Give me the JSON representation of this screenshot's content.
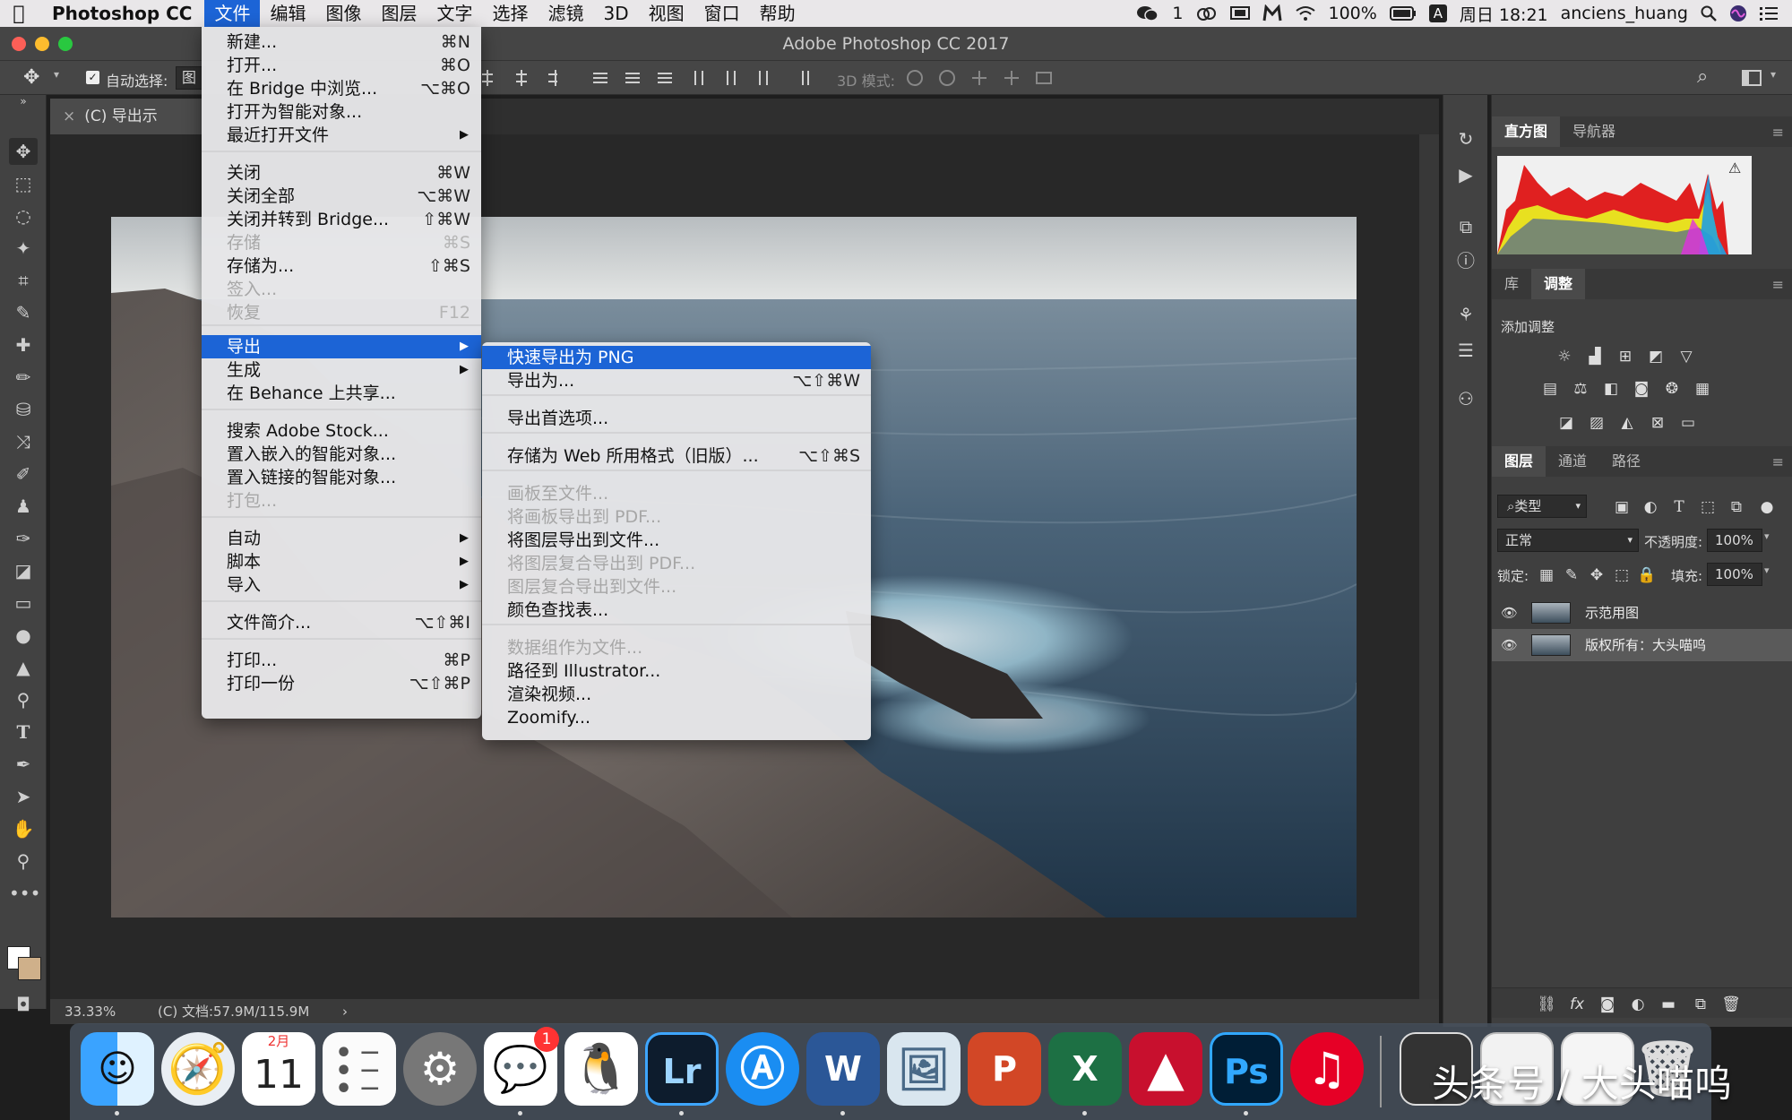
{
  "menubar": {
    "app_name": "Photoshop CC",
    "items": [
      "文件",
      "编辑",
      "图像",
      "图层",
      "文字",
      "选择",
      "滤镜",
      "3D",
      "视图",
      "窗口",
      "帮助"
    ],
    "wechat_count": "1",
    "battery": "100%",
    "datetime": "周日 18:21",
    "user": "anciens_huang",
    "input_method": "A"
  },
  "window": {
    "title": "Adobe Photoshop CC 2017"
  },
  "options_bar": {
    "auto_select_label": "自动选择:",
    "auto_select_value": "图层",
    "mode_3d_label": "3D 模式:"
  },
  "document": {
    "tab_title": "(C) 导出示范.psd",
    "zoom": "33.33%",
    "doc_info": "(C) 文档:57.9M/115.9M"
  },
  "file_menu": {
    "items": [
      {
        "label": "新建...",
        "shortcut": "⌘N"
      },
      {
        "label": "打开...",
        "shortcut": "⌘O"
      },
      {
        "label": "在 Bridge 中浏览...",
        "shortcut": "⌥⌘O"
      },
      {
        "label": "打开为智能对象...",
        "shortcut": ""
      },
      {
        "label": "最近打开文件",
        "shortcut": ""
      },
      {
        "label": "关闭",
        "shortcut": "⌘W"
      },
      {
        "label": "关闭全部",
        "shortcut": "⌥⌘W"
      },
      {
        "label": "关闭并转到 Bridge...",
        "shortcut": "⇧⌘W"
      },
      {
        "label": "存储",
        "shortcut": "⌘S"
      },
      {
        "label": "存储为...",
        "shortcut": "⇧⌘S"
      },
      {
        "label": "签入...",
        "shortcut": ""
      },
      {
        "label": "恢复",
        "shortcut": "F12"
      },
      {
        "label": "导出",
        "shortcut": ""
      },
      {
        "label": "生成",
        "shortcut": ""
      },
      {
        "label": "在 Behance 上共享...",
        "shortcut": ""
      },
      {
        "label": "搜索 Adobe Stock...",
        "shortcut": ""
      },
      {
        "label": "置入嵌入的智能对象...",
        "shortcut": ""
      },
      {
        "label": "置入链接的智能对象...",
        "shortcut": ""
      },
      {
        "label": "打包...",
        "shortcut": ""
      },
      {
        "label": "自动",
        "shortcut": ""
      },
      {
        "label": "脚本",
        "shortcut": ""
      },
      {
        "label": "导入",
        "shortcut": ""
      },
      {
        "label": "文件简介...",
        "shortcut": "⌥⇧⌘I"
      },
      {
        "label": "打印...",
        "shortcut": "⌘P"
      },
      {
        "label": "打印一份",
        "shortcut": "⌥⇧⌘P"
      }
    ]
  },
  "export_menu": {
    "items": [
      {
        "label": "快速导出为 PNG",
        "shortcut": ""
      },
      {
        "label": "导出为...",
        "shortcut": "⌥⇧⌘W"
      },
      {
        "label": "导出首选项...",
        "shortcut": ""
      },
      {
        "label": "存储为 Web 所用格式（旧版）...",
        "shortcut": "⌥⇧⌘S"
      },
      {
        "label": "画板至文件...",
        "shortcut": ""
      },
      {
        "label": "将画板导出到 PDF...",
        "shortcut": ""
      },
      {
        "label": "将图层导出到文件...",
        "shortcut": ""
      },
      {
        "label": "将图层复合导出到 PDF...",
        "shortcut": ""
      },
      {
        "label": "图层复合导出到文件...",
        "shortcut": ""
      },
      {
        "label": "颜色查找表...",
        "shortcut": ""
      },
      {
        "label": "数据组作为文件...",
        "shortcut": ""
      },
      {
        "label": "路径到 Illustrator...",
        "shortcut": ""
      },
      {
        "label": "渲染视频...",
        "shortcut": ""
      },
      {
        "label": "Zoomify...",
        "shortcut": ""
      }
    ]
  },
  "panels": {
    "histogram_tabs": [
      "直方图",
      "导航器"
    ],
    "adjust_tabs": [
      "库",
      "调整"
    ],
    "add_adjustment": "添加调整",
    "layers_tabs": [
      "图层",
      "通道",
      "路径"
    ],
    "kind_filter": "类型",
    "blend_mode": "正常",
    "opacity_label": "不透明度:",
    "opacity": "100%",
    "lock_label": "锁定:",
    "fill_label": "填充:",
    "fill": "100%",
    "layers": [
      {
        "name": "示范用图"
      },
      {
        "name": "版权所有：大头喵呜"
      }
    ]
  },
  "dock": {
    "calendar_month": "2月",
    "calendar_day": "11",
    "wechat_badge": "1",
    "lightroom": "Lr",
    "word": "W",
    "powerpoint": "P",
    "excel": "X",
    "photoshop": "Ps"
  },
  "watermark": "头条号 / 大头喵呜"
}
